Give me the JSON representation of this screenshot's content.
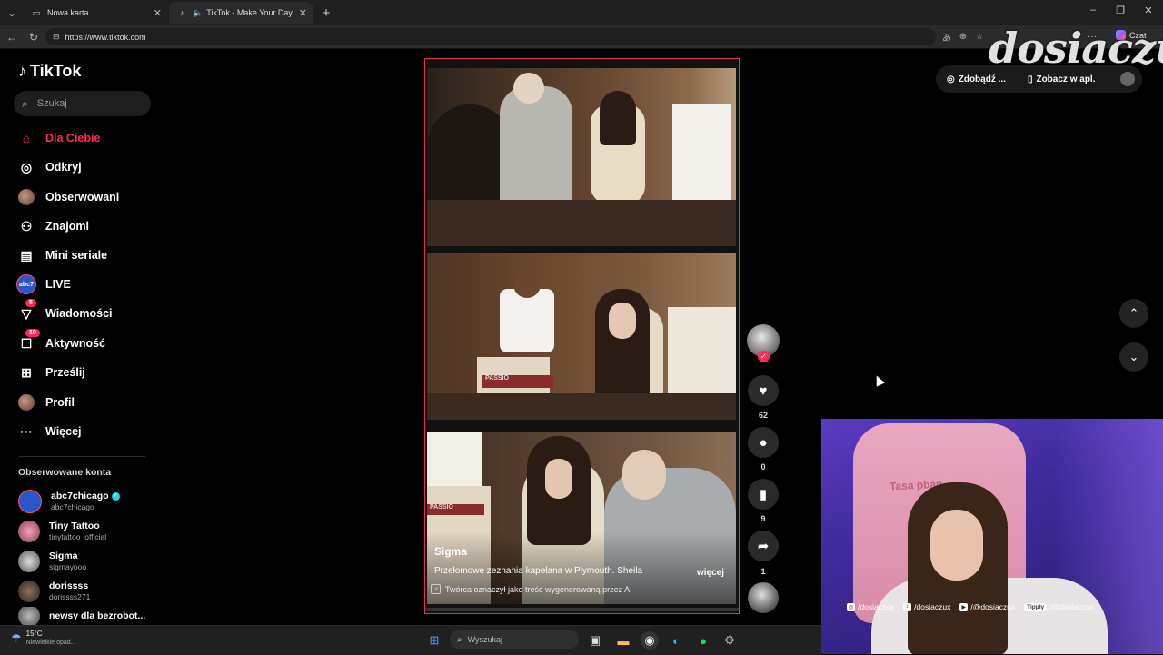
{
  "browser": {
    "tabs": [
      {
        "label": "Nowa karta",
        "active": false
      },
      {
        "label": "TikTok - Make Your Day",
        "active": true
      }
    ],
    "url": "https://www.tiktok.com",
    "czat_label": "Czat"
  },
  "tiktok": {
    "logo": "TikTok",
    "search_placeholder": "Szukaj",
    "nav": [
      {
        "label": "Dla Ciebie",
        "icon": "home-icon",
        "active": true
      },
      {
        "label": "Odkryj",
        "icon": "compass-icon"
      },
      {
        "label": "Obserwowani",
        "icon": "following-avatar-icon"
      },
      {
        "label": "Znajomi",
        "icon": "friends-icon"
      },
      {
        "label": "Mini seriale",
        "icon": "film-icon"
      },
      {
        "label": "LIVE",
        "icon": "live-icon"
      },
      {
        "label": "Wiadomości",
        "icon": "messages-icon",
        "badge": "5"
      },
      {
        "label": "Aktywność",
        "icon": "activity-icon",
        "badge": "18"
      },
      {
        "label": "Prześlij",
        "icon": "upload-icon"
      },
      {
        "label": "Profil",
        "icon": "profile-avatar-icon"
      },
      {
        "label": "Więcej",
        "icon": "more-icon"
      }
    ],
    "following_title": "Obserwowane konta",
    "accounts": [
      {
        "name": "abc7chicago",
        "username": "abc7chicago",
        "verified": true
      },
      {
        "name": "Tiny Tattoo",
        "username": "tinytattoo_official"
      },
      {
        "name": "Sigma",
        "username": "sigmayooo"
      },
      {
        "name": "dorissss",
        "username": "dorissss271"
      },
      {
        "name": "newsy dla bezrobot..."
      }
    ],
    "video": {
      "author": "Sigma",
      "description": "Przełomowe zeznania kapelana w Plymouth. Sheila",
      "more": "więcej",
      "ai_label": "Twórca oznaczył jako treść wygenerowaną przez AI",
      "court_text_1": "PASSIO",
      "court_text_2": "PASSIO",
      "progress": 0.0
    },
    "actions": {
      "likes": "62",
      "comments": "0",
      "saves": "9",
      "shares": "1"
    },
    "top_buttons": {
      "coins": "Zdobądź ...",
      "app": "Zobacz w apl."
    }
  },
  "overlay": {
    "watermark": "dosiaczux",
    "chair_text": "Tasa pban",
    "socials": [
      {
        "icon": "instagram-icon",
        "label": "/dosiaczux"
      },
      {
        "icon": "tiktok-icon",
        "label": "/dosiaczux"
      },
      {
        "icon": "youtube-icon",
        "label": "/@dosiaczux"
      },
      {
        "badge": "Tipply",
        "label": "/@dosiaczux"
      }
    ]
  },
  "taskbar": {
    "temperature": "15°C",
    "weather": "Niewielkie opad...",
    "search_placeholder": "Wyszukaj"
  },
  "colors": {
    "accent": "#fe2c55",
    "video_border": "#e0344e",
    "background": "#000000"
  }
}
